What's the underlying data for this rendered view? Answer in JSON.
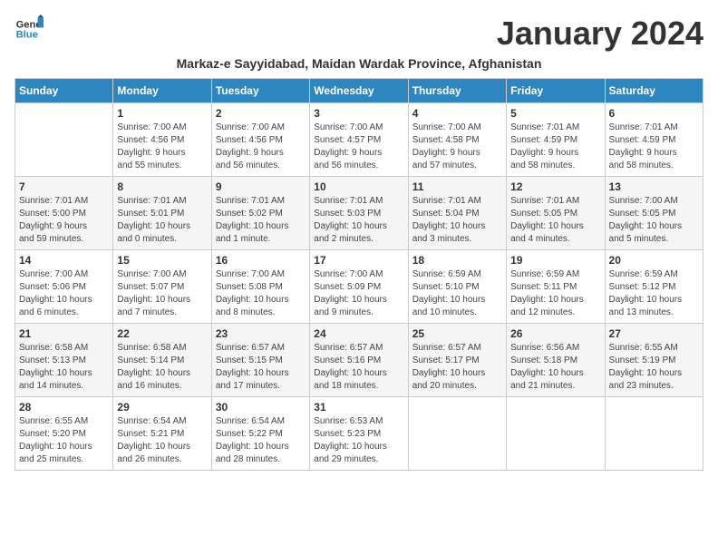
{
  "header": {
    "logo_general": "General",
    "logo_blue": "Blue",
    "month_title": "January 2024",
    "subtitle": "Markaz-e Sayyidabad, Maidan Wardak Province, Afghanistan"
  },
  "days_of_week": [
    "Sunday",
    "Monday",
    "Tuesday",
    "Wednesday",
    "Thursday",
    "Friday",
    "Saturday"
  ],
  "weeks": [
    [
      {
        "day": "",
        "info": ""
      },
      {
        "day": "1",
        "info": "Sunrise: 7:00 AM\nSunset: 4:56 PM\nDaylight: 9 hours\nand 55 minutes."
      },
      {
        "day": "2",
        "info": "Sunrise: 7:00 AM\nSunset: 4:56 PM\nDaylight: 9 hours\nand 56 minutes."
      },
      {
        "day": "3",
        "info": "Sunrise: 7:00 AM\nSunset: 4:57 PM\nDaylight: 9 hours\nand 56 minutes."
      },
      {
        "day": "4",
        "info": "Sunrise: 7:00 AM\nSunset: 4:58 PM\nDaylight: 9 hours\nand 57 minutes."
      },
      {
        "day": "5",
        "info": "Sunrise: 7:01 AM\nSunset: 4:59 PM\nDaylight: 9 hours\nand 58 minutes."
      },
      {
        "day": "6",
        "info": "Sunrise: 7:01 AM\nSunset: 4:59 PM\nDaylight: 9 hours\nand 58 minutes."
      }
    ],
    [
      {
        "day": "7",
        "info": "Sunrise: 7:01 AM\nSunset: 5:00 PM\nDaylight: 9 hours\nand 59 minutes."
      },
      {
        "day": "8",
        "info": "Sunrise: 7:01 AM\nSunset: 5:01 PM\nDaylight: 10 hours\nand 0 minutes."
      },
      {
        "day": "9",
        "info": "Sunrise: 7:01 AM\nSunset: 5:02 PM\nDaylight: 10 hours\nand 1 minute."
      },
      {
        "day": "10",
        "info": "Sunrise: 7:01 AM\nSunset: 5:03 PM\nDaylight: 10 hours\nand 2 minutes."
      },
      {
        "day": "11",
        "info": "Sunrise: 7:01 AM\nSunset: 5:04 PM\nDaylight: 10 hours\nand 3 minutes."
      },
      {
        "day": "12",
        "info": "Sunrise: 7:01 AM\nSunset: 5:05 PM\nDaylight: 10 hours\nand 4 minutes."
      },
      {
        "day": "13",
        "info": "Sunrise: 7:00 AM\nSunset: 5:05 PM\nDaylight: 10 hours\nand 5 minutes."
      }
    ],
    [
      {
        "day": "14",
        "info": "Sunrise: 7:00 AM\nSunset: 5:06 PM\nDaylight: 10 hours\nand 6 minutes."
      },
      {
        "day": "15",
        "info": "Sunrise: 7:00 AM\nSunset: 5:07 PM\nDaylight: 10 hours\nand 7 minutes."
      },
      {
        "day": "16",
        "info": "Sunrise: 7:00 AM\nSunset: 5:08 PM\nDaylight: 10 hours\nand 8 minutes."
      },
      {
        "day": "17",
        "info": "Sunrise: 7:00 AM\nSunset: 5:09 PM\nDaylight: 10 hours\nand 9 minutes."
      },
      {
        "day": "18",
        "info": "Sunrise: 6:59 AM\nSunset: 5:10 PM\nDaylight: 10 hours\nand 10 minutes."
      },
      {
        "day": "19",
        "info": "Sunrise: 6:59 AM\nSunset: 5:11 PM\nDaylight: 10 hours\nand 12 minutes."
      },
      {
        "day": "20",
        "info": "Sunrise: 6:59 AM\nSunset: 5:12 PM\nDaylight: 10 hours\nand 13 minutes."
      }
    ],
    [
      {
        "day": "21",
        "info": "Sunrise: 6:58 AM\nSunset: 5:13 PM\nDaylight: 10 hours\nand 14 minutes."
      },
      {
        "day": "22",
        "info": "Sunrise: 6:58 AM\nSunset: 5:14 PM\nDaylight: 10 hours\nand 16 minutes."
      },
      {
        "day": "23",
        "info": "Sunrise: 6:57 AM\nSunset: 5:15 PM\nDaylight: 10 hours\nand 17 minutes."
      },
      {
        "day": "24",
        "info": "Sunrise: 6:57 AM\nSunset: 5:16 PM\nDaylight: 10 hours\nand 18 minutes."
      },
      {
        "day": "25",
        "info": "Sunrise: 6:57 AM\nSunset: 5:17 PM\nDaylight: 10 hours\nand 20 minutes."
      },
      {
        "day": "26",
        "info": "Sunrise: 6:56 AM\nSunset: 5:18 PM\nDaylight: 10 hours\nand 21 minutes."
      },
      {
        "day": "27",
        "info": "Sunrise: 6:55 AM\nSunset: 5:19 PM\nDaylight: 10 hours\nand 23 minutes."
      }
    ],
    [
      {
        "day": "28",
        "info": "Sunrise: 6:55 AM\nSunset: 5:20 PM\nDaylight: 10 hours\nand 25 minutes."
      },
      {
        "day": "29",
        "info": "Sunrise: 6:54 AM\nSunset: 5:21 PM\nDaylight: 10 hours\nand 26 minutes."
      },
      {
        "day": "30",
        "info": "Sunrise: 6:54 AM\nSunset: 5:22 PM\nDaylight: 10 hours\nand 28 minutes."
      },
      {
        "day": "31",
        "info": "Sunrise: 6:53 AM\nSunset: 5:23 PM\nDaylight: 10 hours\nand 29 minutes."
      },
      {
        "day": "",
        "info": ""
      },
      {
        "day": "",
        "info": ""
      },
      {
        "day": "",
        "info": ""
      }
    ]
  ]
}
